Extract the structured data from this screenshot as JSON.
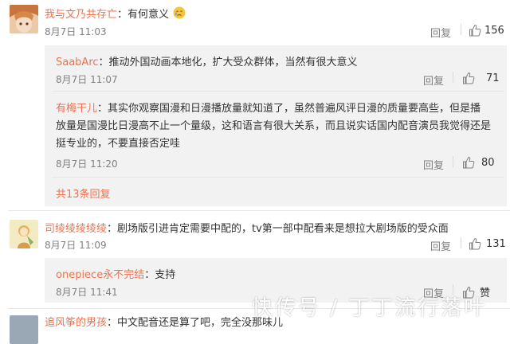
{
  "comments": [
    {
      "user": "我与文乃共存亡",
      "text": "：有何意义",
      "emoji": "crying-face-icon",
      "time": "8月7日 11:03",
      "reply_label": "回复",
      "likes": "156",
      "subreplies": [
        {
          "user": "SaabArc",
          "text": "：推动外国动画本地化，扩大受众群体，当然有很大意义",
          "time": "8月7日 11:07",
          "reply_label": "回复",
          "likes": "71"
        },
        {
          "user": "有梅干儿",
          "text_line1": "：其实你观察国漫和日漫播放量就知道了，虽然普遍风评日漫的质量要高些，但是播",
          "text_line2": "放量是国漫比日漫高不止一个量级，这和语言有很大关系，而且说实话国内配音演员我觉得还是",
          "text_line3": "挺专业的，不要直接否定哇",
          "time": "8月7日 11:20",
          "reply_label": "回复",
          "likes": "80"
        }
      ],
      "more_replies": "共13条回复"
    },
    {
      "user": "司绫绫绫绫绫",
      "text": "：剧场版引进肯定需要中配的，tv第一部中配看来是想拉大剧场版的受众面",
      "time": "8月7日 11:09",
      "reply_label": "回复",
      "likes": "131",
      "subreplies": [
        {
          "user": "onepiece永不完结",
          "text": "：支持",
          "time": "8月7日 11:41",
          "reply_label": "回复",
          "likes": "赞"
        }
      ]
    },
    {
      "user": "追风筝的男孩",
      "text": "：中文配音还是算了吧，完全没那味儿"
    }
  ],
  "watermark": "快传号 / 丁丁流行落叶",
  "colors": {
    "username": "#eb7350",
    "subreply_bg": "#f2f2f2",
    "meta": "#808080"
  }
}
